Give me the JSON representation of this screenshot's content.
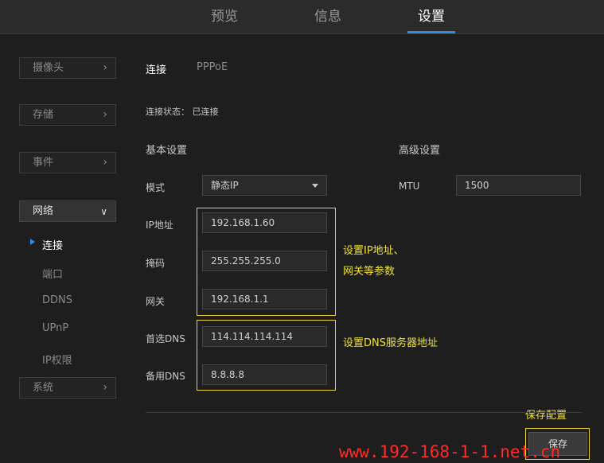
{
  "tabs": [
    {
      "label": "预览",
      "active": false
    },
    {
      "label": "信息",
      "active": false
    },
    {
      "label": "设置",
      "active": true
    }
  ],
  "sidebar": {
    "groups": {
      "camera": "摄像头",
      "storage": "存储",
      "event": "事件",
      "network": "网络",
      "system": "系统"
    },
    "network_items": [
      "连接",
      "端口",
      "DDNS",
      "UPnP",
      "IP权限"
    ],
    "active_item": "连接"
  },
  "main": {
    "subtabs": {
      "connect": "连接",
      "pppoe": "PPPoE"
    },
    "status": "连接状态： 已连接",
    "basic_title": "基本设置",
    "advanced_title": "高级设置",
    "fields": {
      "mode_label": "模式",
      "mode_value": "静态IP",
      "ip_label": "IP地址",
      "ip_value": "192.168.1.60",
      "mask_label": "掩码",
      "mask_value": "255.255.255.0",
      "gateway_label": "网关",
      "gateway_value": "192.168.1.1",
      "dns1_label": "首选DNS",
      "dns1_value": "114.114.114.114",
      "dns2_label": "备用DNS",
      "dns2_value": "8.8.8.8",
      "mtu_label": "MTU",
      "mtu_value": "1500"
    },
    "save_label": "保存"
  },
  "annotations": {
    "ip_note_line1": "设置IP地址、",
    "ip_note_line2": "网关等参数",
    "dns_note": "设置DNS服务器地址",
    "save_note": "保存配置",
    "color": "#f0e040"
  },
  "watermark": "www.192-168-1-1.net.cn",
  "colors": {
    "accent": "#2e8ae6",
    "highlight": "#e6d63a",
    "watermark": "#ff2a2a"
  }
}
